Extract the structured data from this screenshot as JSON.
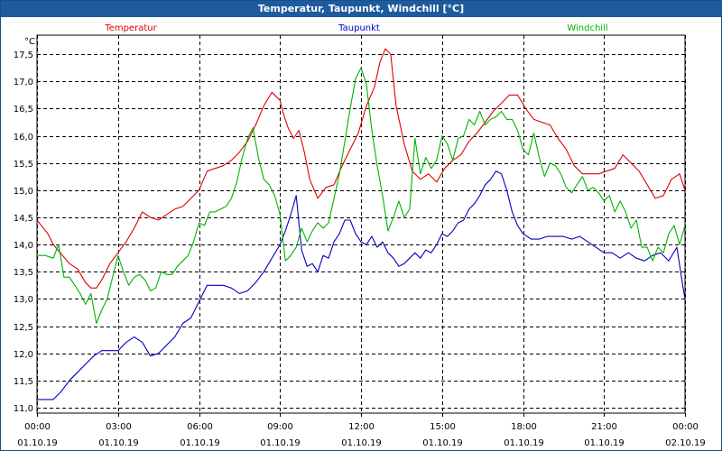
{
  "window": {
    "title": "Temperatur, Taupunkt, Windchill [°C]"
  },
  "chart_data": {
    "type": "line",
    "title": "Temperatur, Taupunkt, Windchill [°C]",
    "ylabel": "°C",
    "xlabel": "",
    "ylim": [
      10.9,
      17.85
    ],
    "xlim": [
      0,
      24
    ],
    "grid": true,
    "y_ticks": [
      11.0,
      11.5,
      12.0,
      12.5,
      13.0,
      13.5,
      14.0,
      14.5,
      15.0,
      15.5,
      16.0,
      16.5,
      17.0,
      17.5
    ],
    "y_tick_labels": [
      "11,0",
      "11,5",
      "12,0",
      "12,5",
      "13,0",
      "13,5",
      "14,0",
      "14,5",
      "15,0",
      "15,5",
      "16,0",
      "16,5",
      "17,0",
      "17,5"
    ],
    "x_ticks": [
      {
        "hour": 0,
        "time": "00:00",
        "date": "01.10.19"
      },
      {
        "hour": 3,
        "time": "03:00",
        "date": "01.10.19"
      },
      {
        "hour": 6,
        "time": "06:00",
        "date": "01.10.19"
      },
      {
        "hour": 9,
        "time": "09:00",
        "date": "01.10.19"
      },
      {
        "hour": 12,
        "time": "12:00",
        "date": "01.10.19"
      },
      {
        "hour": 15,
        "time": "15:00",
        "date": "01.10.19"
      },
      {
        "hour": 18,
        "time": "18:00",
        "date": "01.10.19"
      },
      {
        "hour": 21,
        "time": "21:00",
        "date": "01.10.19"
      },
      {
        "hour": 24,
        "time": "00:00",
        "date": "02.10.19"
      }
    ],
    "legend_position": "top",
    "series": [
      {
        "name": "Temperatur",
        "color": "#e00000",
        "x": [
          0,
          0.4,
          0.6,
          1.2,
          1.5,
          1.8,
          2.0,
          2.2,
          2.4,
          2.7,
          3.0,
          3.3,
          3.6,
          3.9,
          4.2,
          4.5,
          4.8,
          5.1,
          5.4,
          5.7,
          6.0,
          6.3,
          6.6,
          6.9,
          7.2,
          7.5,
          7.8,
          8.1,
          8.4,
          8.7,
          9.0,
          9.1,
          9.3,
          9.5,
          9.7,
          9.9,
          10.1,
          10.4,
          10.7,
          11.0,
          11.3,
          11.6,
          11.9,
          12.2,
          12.5,
          12.7,
          12.9,
          13.1,
          13.3,
          13.6,
          13.9,
          14.2,
          14.5,
          14.8,
          15.1,
          15.4,
          15.7,
          16.0,
          16.3,
          16.6,
          16.9,
          17.2,
          17.5,
          17.8,
          18.1,
          18.4,
          18.7,
          19.0,
          19.3,
          19.6,
          19.9,
          20.2,
          20.5,
          20.8,
          21.1,
          21.4,
          21.7,
          22.0,
          22.3,
          22.6,
          22.9,
          23.2,
          23.5,
          23.8,
          24.0
        ],
        "y": [
          14.45,
          14.2,
          14.0,
          13.65,
          13.55,
          13.3,
          13.2,
          13.2,
          13.35,
          13.65,
          13.85,
          14.05,
          14.3,
          14.6,
          14.5,
          14.45,
          14.55,
          14.65,
          14.7,
          14.85,
          15.0,
          15.35,
          15.4,
          15.45,
          15.55,
          15.7,
          15.9,
          16.2,
          16.55,
          16.8,
          16.65,
          16.45,
          16.15,
          15.95,
          16.1,
          15.7,
          15.2,
          14.85,
          15.05,
          15.1,
          15.45,
          15.75,
          16.05,
          16.55,
          16.9,
          17.35,
          17.6,
          17.5,
          16.55,
          15.85,
          15.35,
          15.2,
          15.3,
          15.15,
          15.4,
          15.55,
          15.65,
          15.9,
          16.05,
          16.25,
          16.45,
          16.6,
          16.75,
          16.75,
          16.5,
          16.3,
          16.25,
          16.2,
          15.95,
          15.75,
          15.45,
          15.3,
          15.3,
          15.3,
          15.35,
          15.4,
          15.65,
          15.5,
          15.35,
          15.1,
          14.85,
          14.9,
          15.2,
          15.3,
          15.0
        ]
      },
      {
        "name": "Taupunkt",
        "color": "#0000c0",
        "x": [
          0,
          0.3,
          0.6,
          0.9,
          1.2,
          1.5,
          1.8,
          2.1,
          2.4,
          2.7,
          3.0,
          3.3,
          3.6,
          3.9,
          4.2,
          4.5,
          4.8,
          5.1,
          5.4,
          5.7,
          6.0,
          6.3,
          6.6,
          6.9,
          7.2,
          7.5,
          7.8,
          8.1,
          8.4,
          8.7,
          9.0,
          9.2,
          9.4,
          9.6,
          9.8,
          10.0,
          10.2,
          10.4,
          10.6,
          10.8,
          11.0,
          11.2,
          11.4,
          11.6,
          11.8,
          12.0,
          12.2,
          12.4,
          12.6,
          12.8,
          13.0,
          13.2,
          13.4,
          13.6,
          13.8,
          14.0,
          14.2,
          14.4,
          14.6,
          14.8,
          15.0,
          15.2,
          15.4,
          15.6,
          15.8,
          16.0,
          16.2,
          16.4,
          16.6,
          16.8,
          17.0,
          17.2,
          17.4,
          17.6,
          17.8,
          18.0,
          18.3,
          18.6,
          18.9,
          19.2,
          19.5,
          19.8,
          20.1,
          20.4,
          20.7,
          21.0,
          21.3,
          21.6,
          21.9,
          22.2,
          22.5,
          22.8,
          23.1,
          23.4,
          23.7,
          23.9,
          24.0
        ],
        "y": [
          11.15,
          11.15,
          11.15,
          11.3,
          11.5,
          11.65,
          11.8,
          11.95,
          12.05,
          12.05,
          12.05,
          12.2,
          12.3,
          12.2,
          11.95,
          12.0,
          12.15,
          12.3,
          12.55,
          12.65,
          12.95,
          13.25,
          13.25,
          13.25,
          13.2,
          13.1,
          13.15,
          13.3,
          13.5,
          13.75,
          14.0,
          14.25,
          14.55,
          14.9,
          13.9,
          13.6,
          13.65,
          13.5,
          13.8,
          13.75,
          14.05,
          14.2,
          14.45,
          14.45,
          14.2,
          14.05,
          14.0,
          14.15,
          13.95,
          14.05,
          13.85,
          13.75,
          13.6,
          13.65,
          13.75,
          13.85,
          13.75,
          13.9,
          13.85,
          14.0,
          14.2,
          14.15,
          14.25,
          14.4,
          14.45,
          14.65,
          14.75,
          14.9,
          15.1,
          15.2,
          15.35,
          15.3,
          15.0,
          14.6,
          14.35,
          14.2,
          14.1,
          14.1,
          14.15,
          14.15,
          14.15,
          14.1,
          14.15,
          14.05,
          13.95,
          13.85,
          13.85,
          13.75,
          13.85,
          13.75,
          13.7,
          13.8,
          13.85,
          13.7,
          13.95,
          13.3,
          13.0
        ]
      },
      {
        "name": "Windchill",
        "color": "#00b400",
        "x": [
          0,
          0.3,
          0.6,
          0.8,
          1.0,
          1.2,
          1.4,
          1.6,
          1.8,
          2.0,
          2.2,
          2.4,
          2.6,
          2.8,
          3.0,
          3.2,
          3.4,
          3.6,
          3.8,
          4.0,
          4.2,
          4.4,
          4.6,
          4.8,
          5.0,
          5.2,
          5.4,
          5.6,
          5.8,
          6.0,
          6.2,
          6.4,
          6.6,
          6.8,
          7.0,
          7.2,
          7.4,
          7.6,
          7.8,
          8.0,
          8.2,
          8.4,
          8.6,
          8.8,
          9.0,
          9.2,
          9.4,
          9.6,
          9.8,
          10.0,
          10.2,
          10.4,
          10.6,
          10.8,
          11.0,
          11.2,
          11.4,
          11.6,
          11.8,
          12.0,
          12.2,
          12.4,
          12.6,
          12.8,
          13.0,
          13.2,
          13.4,
          13.6,
          13.8,
          14.0,
          14.2,
          14.4,
          14.6,
          14.8,
          15.0,
          15.2,
          15.4,
          15.6,
          15.8,
          16.0,
          16.2,
          16.4,
          16.6,
          16.8,
          17.0,
          17.2,
          17.4,
          17.6,
          17.8,
          18.0,
          18.2,
          18.4,
          18.6,
          18.8,
          19.0,
          19.2,
          19.4,
          19.6,
          19.8,
          20.0,
          20.2,
          20.4,
          20.6,
          20.8,
          21.0,
          21.2,
          21.4,
          21.6,
          21.8,
          22.0,
          22.2,
          22.4,
          22.6,
          22.8,
          23.0,
          23.2,
          23.4,
          23.6,
          23.8,
          24.0
        ],
        "y": [
          13.8,
          13.8,
          13.75,
          14.0,
          13.4,
          13.4,
          13.25,
          13.1,
          12.9,
          13.1,
          12.55,
          12.8,
          13.0,
          13.4,
          13.8,
          13.5,
          13.25,
          13.4,
          13.45,
          13.35,
          13.15,
          13.2,
          13.5,
          13.45,
          13.45,
          13.6,
          13.7,
          13.8,
          14.05,
          14.4,
          14.35,
          14.6,
          14.6,
          14.65,
          14.7,
          14.85,
          15.15,
          15.6,
          15.95,
          16.15,
          15.6,
          15.2,
          15.1,
          14.9,
          14.55,
          13.7,
          13.8,
          13.95,
          14.3,
          14.05,
          14.25,
          14.4,
          14.3,
          14.4,
          14.85,
          15.3,
          15.9,
          16.5,
          17.05,
          17.25,
          16.95,
          16.1,
          15.45,
          14.9,
          14.25,
          14.5,
          14.8,
          14.5,
          14.65,
          15.95,
          15.3,
          15.6,
          15.4,
          15.55,
          16.0,
          15.85,
          15.55,
          15.95,
          16.0,
          16.3,
          16.2,
          16.45,
          16.2,
          16.3,
          16.35,
          16.45,
          16.3,
          16.3,
          16.1,
          15.75,
          15.65,
          16.05,
          15.6,
          15.25,
          15.5,
          15.45,
          15.3,
          15.05,
          14.95,
          15.1,
          15.25,
          15.0,
          15.05,
          14.95,
          14.8,
          14.9,
          14.6,
          14.8,
          14.6,
          14.3,
          14.45,
          13.95,
          13.95,
          13.7,
          13.95,
          13.85,
          14.2,
          14.35,
          14.0,
          14.35
        ]
      }
    ]
  }
}
